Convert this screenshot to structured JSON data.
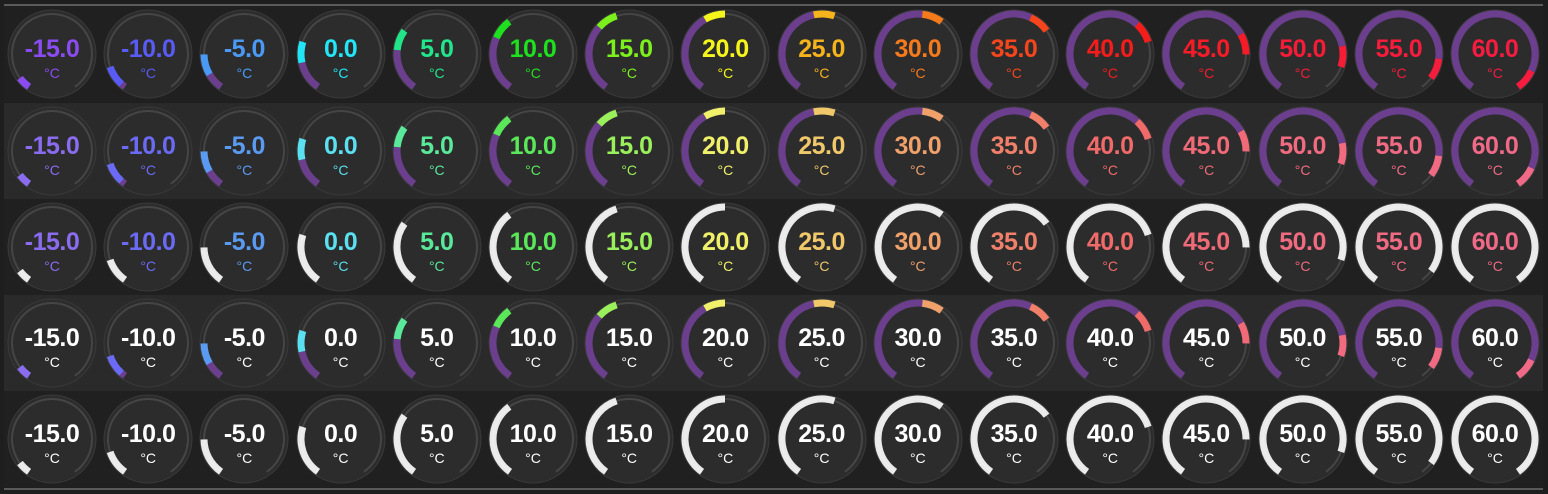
{
  "unit": "°C",
  "values": [
    -15,
    -10,
    -5,
    0,
    5,
    10,
    15,
    20,
    25,
    30,
    35,
    40,
    45,
    50,
    55,
    60
  ],
  "value_labels": [
    "-15.0",
    "-10.0",
    "-5.0",
    "0.0",
    "5.0",
    "10.0",
    "15.0",
    "20.0",
    "25.0",
    "30.0",
    "35.0",
    "40.0",
    "45.0",
    "50.0",
    "55.0",
    "60.0"
  ],
  "range": [
    -20,
    60
  ],
  "colors": {
    "vivid": [
      "#8a4cf0",
      "#5a5af5",
      "#4a9af5",
      "#22e5f5",
      "#22e58a",
      "#1ee01e",
      "#7cf01c",
      "#f5f51c",
      "#f5b41c",
      "#f57a1c",
      "#f5451c",
      "#f51c1c",
      "#f51c28",
      "#f51c38",
      "#f51c3c",
      "#f51c40"
    ],
    "pastel": [
      "#8a6cf0",
      "#6a6af5",
      "#5a9af0",
      "#5ae0f0",
      "#5ae89a",
      "#5ae85a",
      "#9af05a",
      "#f0f06a",
      "#f0c86a",
      "#f0a06a",
      "#f0806a",
      "#f06a6a",
      "#f06a78",
      "#f06a80",
      "#f06a84",
      "#f06a88"
    ],
    "purple": "#6b3f8e",
    "white": "#ffffff",
    "track": "#454545",
    "face": "#2c2c2c"
  },
  "rows": [
    {
      "text": "vivid",
      "arc": "gradient",
      "gradient": "vivid"
    },
    {
      "text": "pastel",
      "arc": "gradient",
      "gradient": "pastel"
    },
    {
      "text": "pastel",
      "arc": "white"
    },
    {
      "text": "white",
      "arc": "gradient",
      "gradient": "pastel"
    },
    {
      "text": "white",
      "arc": "white"
    }
  ],
  "gauges": {
    "r0": [
      {
        "value": "-15.0",
        "unit": "°C"
      },
      {
        "value": "-10.0",
        "unit": "°C"
      },
      {
        "value": "-5.0",
        "unit": "°C"
      },
      {
        "value": "0.0",
        "unit": "°C"
      },
      {
        "value": "5.0",
        "unit": "°C"
      },
      {
        "value": "10.0",
        "unit": "°C"
      },
      {
        "value": "15.0",
        "unit": "°C"
      },
      {
        "value": "20.0",
        "unit": "°C"
      },
      {
        "value": "25.0",
        "unit": "°C"
      },
      {
        "value": "30.0",
        "unit": "°C"
      },
      {
        "value": "35.0",
        "unit": "°C"
      },
      {
        "value": "40.0",
        "unit": "°C"
      },
      {
        "value": "45.0",
        "unit": "°C"
      },
      {
        "value": "50.0",
        "unit": "°C"
      },
      {
        "value": "55.0",
        "unit": "°C"
      },
      {
        "value": "60.0",
        "unit": "°C"
      }
    ],
    "r1": [
      {
        "value": "-15.0",
        "unit": "°C"
      },
      {
        "value": "-10.0",
        "unit": "°C"
      },
      {
        "value": "-5.0",
        "unit": "°C"
      },
      {
        "value": "0.0",
        "unit": "°C"
      },
      {
        "value": "5.0",
        "unit": "°C"
      },
      {
        "value": "10.0",
        "unit": "°C"
      },
      {
        "value": "15.0",
        "unit": "°C"
      },
      {
        "value": "20.0",
        "unit": "°C"
      },
      {
        "value": "25.0",
        "unit": "°C"
      },
      {
        "value": "30.0",
        "unit": "°C"
      },
      {
        "value": "35.0",
        "unit": "°C"
      },
      {
        "value": "40.0",
        "unit": "°C"
      },
      {
        "value": "45.0",
        "unit": "°C"
      },
      {
        "value": "50.0",
        "unit": "°C"
      },
      {
        "value": "55.0",
        "unit": "°C"
      },
      {
        "value": "60.0",
        "unit": "°C"
      }
    ],
    "r2": [
      {
        "value": "-15.0",
        "unit": "°C"
      },
      {
        "value": "-10.0",
        "unit": "°C"
      },
      {
        "value": "-5.0",
        "unit": "°C"
      },
      {
        "value": "0.0",
        "unit": "°C"
      },
      {
        "value": "5.0",
        "unit": "°C"
      },
      {
        "value": "10.0",
        "unit": "°C"
      },
      {
        "value": "15.0",
        "unit": "°C"
      },
      {
        "value": "20.0",
        "unit": "°C"
      },
      {
        "value": "25.0",
        "unit": "°C"
      },
      {
        "value": "30.0",
        "unit": "°C"
      },
      {
        "value": "35.0",
        "unit": "°C"
      },
      {
        "value": "40.0",
        "unit": "°C"
      },
      {
        "value": "45.0",
        "unit": "°C"
      },
      {
        "value": "50.0",
        "unit": "°C"
      },
      {
        "value": "55.0",
        "unit": "°C"
      },
      {
        "value": "60.0",
        "unit": "°C"
      }
    ],
    "r3": [
      {
        "value": "-15.0",
        "unit": "°C"
      },
      {
        "value": "-10.0",
        "unit": "°C"
      },
      {
        "value": "-5.0",
        "unit": "°C"
      },
      {
        "value": "0.0",
        "unit": "°C"
      },
      {
        "value": "5.0",
        "unit": "°C"
      },
      {
        "value": "10.0",
        "unit": "°C"
      },
      {
        "value": "15.0",
        "unit": "°C"
      },
      {
        "value": "20.0",
        "unit": "°C"
      },
      {
        "value": "25.0",
        "unit": "°C"
      },
      {
        "value": "30.0",
        "unit": "°C"
      },
      {
        "value": "35.0",
        "unit": "°C"
      },
      {
        "value": "40.0",
        "unit": "°C"
      },
      {
        "value": "45.0",
        "unit": "°C"
      },
      {
        "value": "50.0",
        "unit": "°C"
      },
      {
        "value": "55.0",
        "unit": "°C"
      },
      {
        "value": "60.0",
        "unit": "°C"
      }
    ],
    "r4": [
      {
        "value": "-15.0",
        "unit": "°C"
      },
      {
        "value": "-10.0",
        "unit": "°C"
      },
      {
        "value": "-5.0",
        "unit": "°C"
      },
      {
        "value": "0.0",
        "unit": "°C"
      },
      {
        "value": "5.0",
        "unit": "°C"
      },
      {
        "value": "10.0",
        "unit": "°C"
      },
      {
        "value": "15.0",
        "unit": "°C"
      },
      {
        "value": "20.0",
        "unit": "°C"
      },
      {
        "value": "25.0",
        "unit": "°C"
      },
      {
        "value": "30.0",
        "unit": "°C"
      },
      {
        "value": "35.0",
        "unit": "°C"
      },
      {
        "value": "40.0",
        "unit": "°C"
      },
      {
        "value": "45.0",
        "unit": "°C"
      },
      {
        "value": "50.0",
        "unit": "°C"
      },
      {
        "value": "55.0",
        "unit": "°C"
      },
      {
        "value": "60.0",
        "unit": "°C"
      }
    ]
  }
}
